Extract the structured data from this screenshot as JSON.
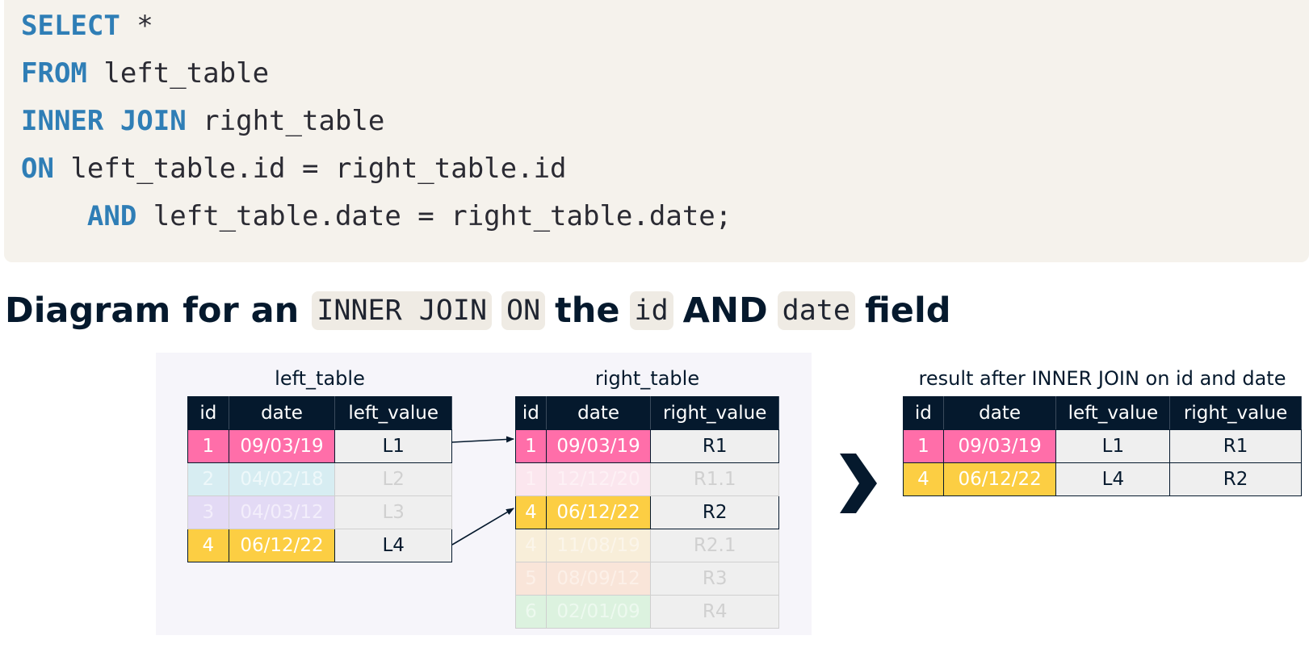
{
  "code": {
    "lines": [
      {
        "kw": "SELECT",
        "rest": " *"
      },
      {
        "kw": "FROM",
        "rest": " left_table"
      },
      {
        "kw": "INNER JOIN",
        "rest": " right_table"
      },
      {
        "kw": "ON",
        "rest": " left_table.id = right_table.id"
      },
      {
        "kw": "AND",
        "rest": " left_table.date = right_table.date;",
        "indent": "    "
      }
    ]
  },
  "heading": {
    "prefix": "Diagram for an",
    "pill1": "INNER JOIN",
    "pill2": "ON",
    "word1": "the",
    "pill3": "id",
    "word2": "AND",
    "pill4": "date",
    "word3": "field"
  },
  "left_table": {
    "title": "left_table",
    "headers": [
      "id",
      "date",
      "left_value"
    ],
    "rows": [
      {
        "id": "1",
        "date": "09/03/19",
        "value": "L1"
      },
      {
        "id": "2",
        "date": "04/02/18",
        "value": "L2"
      },
      {
        "id": "3",
        "date": "04/03/12",
        "value": "L3"
      },
      {
        "id": "4",
        "date": "06/12/22",
        "value": "L4"
      }
    ]
  },
  "right_table": {
    "title": "right_table",
    "headers": [
      "id",
      "date",
      "right_value"
    ],
    "rows": [
      {
        "id": "1",
        "date": "09/03/19",
        "value": "R1"
      },
      {
        "id": "1",
        "date": "12/12/20",
        "value": "R1.1"
      },
      {
        "id": "4",
        "date": "06/12/22",
        "value": "R2"
      },
      {
        "id": "4",
        "date": "11/08/19",
        "value": "R2.1"
      },
      {
        "id": "5",
        "date": "08/09/12",
        "value": "R3"
      },
      {
        "id": "6",
        "date": "02/01/09",
        "value": "R4"
      }
    ]
  },
  "result_table": {
    "title": "result after INNER JOIN on id and date",
    "headers": [
      "id",
      "date",
      "left_value",
      "right_value"
    ],
    "rows": [
      {
        "id": "1",
        "date": "09/03/19",
        "left": "L1",
        "right": "R1"
      },
      {
        "id": "4",
        "date": "06/12/22",
        "left": "L4",
        "right": "R2"
      }
    ]
  },
  "colors": {
    "code_bg": "#f5f2ec",
    "keyword": "#2f7eb6",
    "navy": "#05192d",
    "pink": "#ff6ea9",
    "yellow": "#fcce43"
  }
}
